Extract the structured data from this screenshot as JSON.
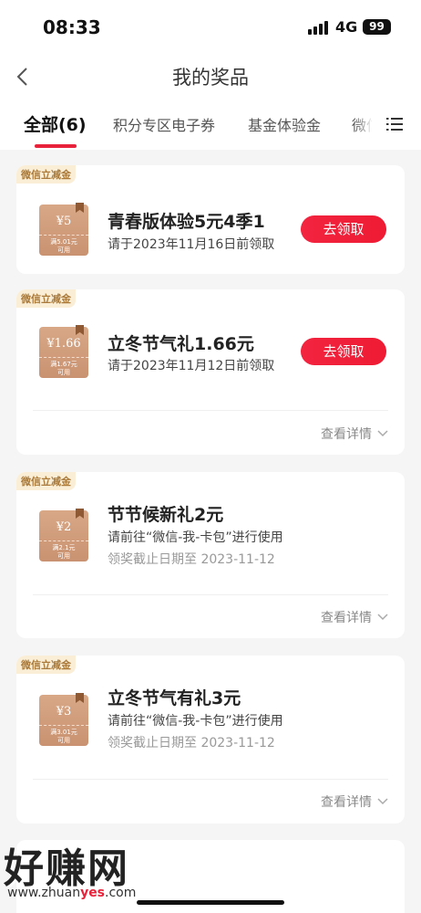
{
  "status": {
    "time": "08:33",
    "network": "4G",
    "battery": "99"
  },
  "nav": {
    "title": "我的奖品"
  },
  "tabs": [
    {
      "label": "全部(6)"
    },
    {
      "label": "积分专区电子券"
    },
    {
      "label": "基金体验金"
    },
    {
      "label": "微信"
    }
  ],
  "cards": [
    {
      "tag": "微信立减金",
      "coupon_amount": "¥5",
      "coupon_cond": "满5.01元\n可用",
      "title": "青春版体验5元4季1",
      "subtitle": "请于2023年11月16日前领取",
      "button": "去领取"
    },
    {
      "tag": "微信立减金",
      "coupon_amount": "¥1.66",
      "coupon_cond": "满1.67元\n可用",
      "title": "立冬节气礼1.66元",
      "subtitle": "请于2023年11月12日前领取",
      "button": "去领取",
      "detail": "查看详情"
    },
    {
      "tag": "微信立减金",
      "coupon_amount": "¥2",
      "coupon_cond": "满2.1元\n可用",
      "title": "节节候新礼2元",
      "subtitle": "请前往“微信-我-卡包”进行使用",
      "deadline": "领奖截止日期至  2023-11-12",
      "detail": "查看详情"
    },
    {
      "tag": "微信立减金",
      "coupon_amount": "¥3",
      "coupon_cond": "满3.01元\n可用",
      "title": "立冬节气有礼3元",
      "subtitle": "请前往“微信-我-卡包”进行使用",
      "deadline": "领奖截止日期至  2023-11-12",
      "detail": "查看详情"
    }
  ],
  "watermark": {
    "text": "好赚网",
    "url_pre": "www.zhuan",
    "url_mid": "yes",
    "url_post": ".com"
  },
  "colors": {
    "accent": "#e8223a",
    "coupon": "#c99271",
    "tag_text": "#a97a3a"
  }
}
